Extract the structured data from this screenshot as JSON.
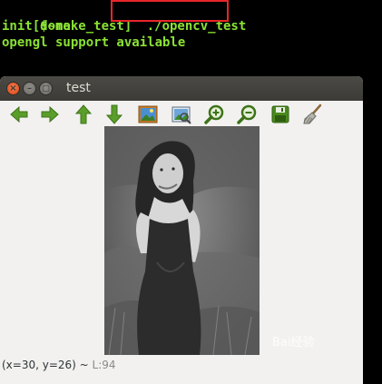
{
  "terminal": {
    "prompt": "[$~make_test]",
    "command": "./opencv_test",
    "lines": [
      "init done",
      "opengl support available"
    ]
  },
  "window": {
    "title": "test",
    "close_glyph": "×",
    "min_glyph": "–",
    "max_glyph": "□"
  },
  "toolbar": {
    "items": [
      "arrow-left-icon",
      "arrow-right-icon",
      "arrow-up-icon",
      "arrow-down-icon",
      "image-icon",
      "image-zoom-icon",
      "zoom-in-icon",
      "zoom-out-icon",
      "save-icon",
      "broom-icon"
    ]
  },
  "status": {
    "coords": "(x=30, y=26) ~ ",
    "level": "L:94"
  },
  "watermark": {
    "text": "Bai经验"
  },
  "colors": {
    "terminal_green": "#8ae234",
    "highlight_red": "#e8262a",
    "icon_green": "#4e9a06"
  }
}
